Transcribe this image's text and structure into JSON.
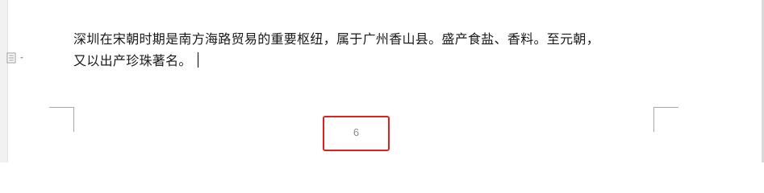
{
  "document": {
    "paragraph": {
      "lines": [
        "深圳在宋朝时期是南方海路贸易的重要枢纽，属于广州香山县。盛产食盐、香料。至元朝，",
        "又以出产珍珠著名。"
      ]
    },
    "footer": {
      "page_number": "6"
    }
  },
  "icons": {
    "paragraph_marker": "paragraph-style-icon"
  },
  "colors": {
    "highlight_box": "#e0201f",
    "text": "#1a1a1a",
    "page_number": "#8a8a8a",
    "crop_marks": "#a8a8a8"
  }
}
